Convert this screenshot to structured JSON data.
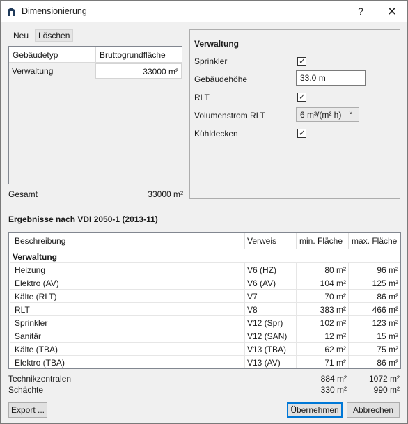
{
  "window": {
    "title": "Dimensionierung",
    "help_label": "?",
    "close_label": "✕"
  },
  "toolbar": {
    "new_label": "Neu",
    "delete_label": "Löschen"
  },
  "building_table": {
    "columns": [
      "Gebäudetyp",
      "Bruttogrundfläche"
    ],
    "rows": [
      {
        "type": "Verwaltung",
        "area": "33000 m²"
      }
    ]
  },
  "summary": {
    "label": "Gesamt",
    "value": "33000 m²"
  },
  "properties": {
    "title": "Verwaltung",
    "sprinkler_label": "Sprinkler",
    "sprinkler_checked": true,
    "height_label": "Gebäudehöhe",
    "height_value": "33.0 m",
    "rlt_label": "RLT",
    "rlt_checked": true,
    "airflow_label": "Volumenstrom RLT",
    "airflow_value": "6 m³/(m² h)",
    "cooling_label": "Kühldecken",
    "cooling_checked": true
  },
  "results": {
    "title": "Ergebnisse nach VDI 2050-1 (2013-11)",
    "columns": [
      "Beschreibung",
      "Verweis",
      "min. Fläche",
      "max. Fläche"
    ],
    "group": "Verwaltung",
    "rows": [
      {
        "desc": "Heizung",
        "ref": "V6 (HZ)",
        "min": "80 m²",
        "max": "96 m²"
      },
      {
        "desc": "Elektro (AV)",
        "ref": "V6 (AV)",
        "min": "104 m²",
        "max": "125 m²"
      },
      {
        "desc": "Kälte (RLT)",
        "ref": "V7",
        "min": "70 m²",
        "max": "86 m²"
      },
      {
        "desc": "RLT",
        "ref": "V8",
        "min": "383 m²",
        "max": "466 m²"
      },
      {
        "desc": "Sprinkler",
        "ref": "V12 (Spr)",
        "min": "102 m²",
        "max": "123 m²"
      },
      {
        "desc": "Sanitär",
        "ref": "V12 (SAN)",
        "min": "12 m²",
        "max": "15 m²"
      },
      {
        "desc": "Kälte (TBA)",
        "ref": "V13 (TBA)",
        "min": "62 m²",
        "max": "75 m²"
      },
      {
        "desc": "Elektro (TBA)",
        "ref": "V13 (AV)",
        "min": "71 m²",
        "max": "86 m²"
      }
    ]
  },
  "totals": [
    {
      "label": "Technikzentralen",
      "min": "884 m²",
      "max": "1072 m²"
    },
    {
      "label": "Schächte",
      "min": "330 m²",
      "max": "990 m²"
    }
  ],
  "buttons": {
    "export": "Export ...",
    "apply": "Übernehmen",
    "cancel": "Abbrechen"
  }
}
